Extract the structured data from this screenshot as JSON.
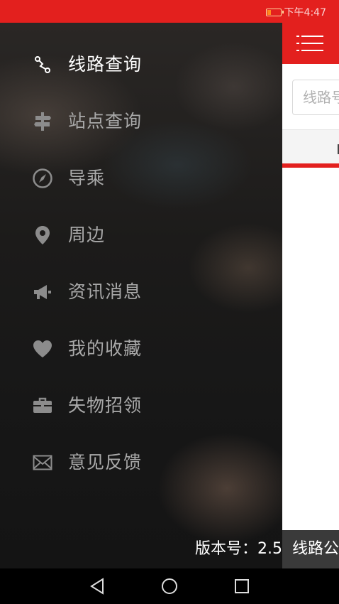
{
  "status_bar": {
    "time": "下午4:47",
    "icons": [
      "battery-low-icon"
    ]
  },
  "drawer": {
    "items": [
      {
        "label": "线路查询",
        "icon": "route-icon",
        "active": true
      },
      {
        "label": "站点查询",
        "icon": "signpost-icon",
        "active": false
      },
      {
        "label": "导乘",
        "icon": "compass-icon",
        "active": false
      },
      {
        "label": "周边",
        "icon": "location-pin-icon",
        "active": false
      },
      {
        "label": "资讯消息",
        "icon": "megaphone-icon",
        "active": false
      },
      {
        "label": "我的收藏",
        "icon": "heart-icon",
        "active": false
      },
      {
        "label": "失物招领",
        "icon": "briefcase-icon",
        "active": false
      },
      {
        "label": "意见反馈",
        "icon": "envelope-icon",
        "active": false
      }
    ],
    "version_text": "版本号：2.5"
  },
  "main": {
    "menu_icon": "hamburger-menu-icon",
    "search_placeholder": "线路号",
    "bottom_tab_label": "线路公交"
  },
  "colors": {
    "accent": "#e3201e",
    "drawer_text": "#a9a9a9",
    "drawer_text_active": "#ffffff"
  },
  "navigation_bar": {
    "buttons": [
      "back-icon",
      "home-icon",
      "recent-apps-icon"
    ]
  }
}
